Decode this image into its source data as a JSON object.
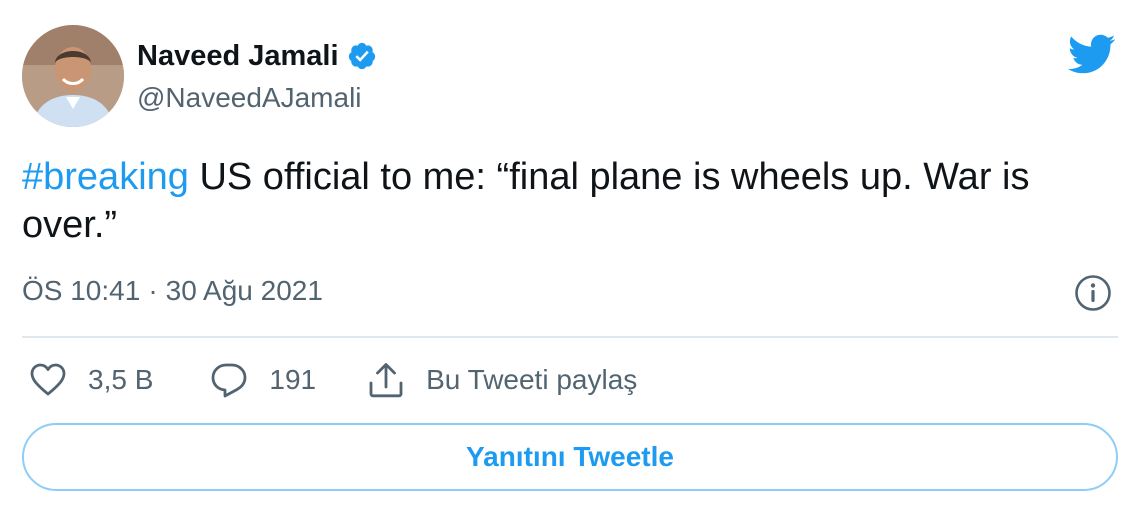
{
  "author": {
    "name": "Naveed Jamali",
    "handle": "@NaveedAJamali",
    "verified": true
  },
  "tweet": {
    "hashtag": "#breaking",
    "text": " US official to me: “final plane is wheels up. War is over.”"
  },
  "meta": {
    "time": "ÖS 10:41",
    "separator": "·",
    "date": "30 Ağu 2021"
  },
  "actions": {
    "likes": "3,5 B",
    "replies": "191",
    "share_label": "Bu Tweeti paylaş"
  },
  "reply_button_label": "Yanıtını Tweetle",
  "icons": {
    "brand": "twitter-bird-icon",
    "verified": "verified-badge-icon",
    "info": "info-icon",
    "like": "heart-icon",
    "reply": "speech-bubble-icon",
    "share": "share-icon"
  },
  "colors": {
    "accent": "#1d9bf0",
    "text": "#0f1419",
    "secondary": "#536471",
    "divider": "#e1e8ed",
    "button_border": "#8ecdf8"
  }
}
